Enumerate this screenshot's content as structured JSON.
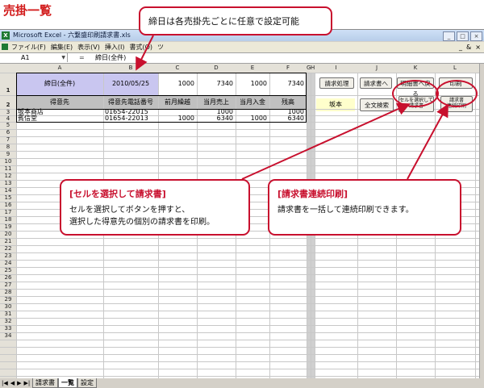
{
  "page_title": "売掛一覧",
  "window": {
    "title": "Microsoft Excel - 六繋盛印刷請求書.xls",
    "app_icon": "X",
    "minimize": "_",
    "maximize": "□",
    "close": "×"
  },
  "menu": {
    "items": [
      "ファイル(F)",
      "編集(E)",
      "表示(V)",
      "挿入(I)",
      "書式(O)",
      "ツ"
    ],
    "right": [
      "_",
      "&",
      "×"
    ]
  },
  "formula_bar": {
    "name_box": "A1",
    "fx": "=",
    "value": "締日(全件)"
  },
  "columns": [
    "A",
    "B",
    "C",
    "D",
    "E",
    "F",
    "G",
    "H",
    "I",
    "J",
    "K",
    "L"
  ],
  "rows": [
    "1",
    "2",
    "3",
    "4",
    "5",
    "6",
    "7",
    "8",
    "9",
    "10",
    "11",
    "12",
    "13",
    "14",
    "15",
    "16",
    "17",
    "18",
    "19",
    "20",
    "21",
    "22",
    "23",
    "24",
    "25",
    "26",
    "27",
    "28",
    "29",
    "30",
    "31",
    "32",
    "33",
    "34"
  ],
  "sheet": {
    "row1": {
      "a": "締日(全件)",
      "b": "2010/05/25",
      "c": "1000",
      "d": "7340",
      "e": "1000",
      "f": "7340"
    },
    "headers": [
      "得意先",
      "得意先電話番号",
      "前月繰越",
      "当月売上",
      "当月入金",
      "残高"
    ],
    "data_rows": [
      {
        "name": "坂本商店",
        "tel": "01654-22015",
        "prev": "",
        "sales": "1000",
        "paid": "",
        "balance": "1000"
      },
      {
        "name": "賓信堂",
        "tel": "01654-22013",
        "prev": "1000",
        "sales": "6340",
        "paid": "1000",
        "balance": "6340"
      }
    ],
    "selected_name": "坂本"
  },
  "sheet_buttons": {
    "invoice_process": "請求処理",
    "to_invoice": "請求書へ",
    "back_to_statement": "明細書へ戻る",
    "print": "印刷",
    "search_all": "全文検索",
    "select_cell_invoice_line1": "セルを選択して",
    "select_cell_invoice_line2": "請求書",
    "continuous_print_line1": "請求書",
    "continuous_print_line2": "連続印刷"
  },
  "sheet_tabs": {
    "nav": [
      "|◀",
      "◀",
      "▶",
      "▶|"
    ],
    "tabs": [
      "請求書",
      "一覧",
      "設定"
    ]
  },
  "callouts": {
    "top": {
      "text": "締日は各売掛先ごとに任意で設定可能"
    },
    "left": {
      "title": "[セルを選択して請求書]",
      "line1": "セルを選択してボタンを押すと、",
      "line2": "選択した得意先の個別の請求書を印刷。"
    },
    "right": {
      "title": "[請求書連続印刷]",
      "line1": "請求書を一括して連続印刷できます。"
    }
  },
  "colors": {
    "accent_red": "#c8102e",
    "title_red": "#d21c1c",
    "header_purple": "#c9c6f0",
    "header_gray": "#c0c0c0",
    "name_yellow": "#ffffcc"
  }
}
